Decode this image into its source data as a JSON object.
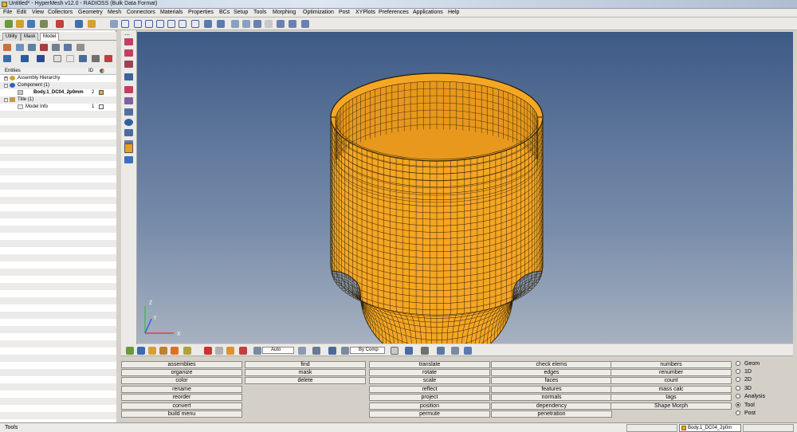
{
  "window": {
    "title": "Untitled* - HyperMesh v12.0 - RADIOSS (Bulk Data Format)"
  },
  "menu": [
    "File",
    "Edit",
    "View",
    "Collectors",
    "Geometry",
    "Mesh",
    "Connectors",
    "Materials",
    "Properties",
    "BCs",
    "Setup",
    "Tools",
    "Morphing",
    "Optimization",
    "Post",
    "XYPlots",
    "Preferences",
    "Applications",
    "Help"
  ],
  "tabs": [
    "Utility",
    "Mask",
    "Model"
  ],
  "entities": {
    "header": {
      "name": "Entities",
      "id": "ID"
    },
    "rows": [
      {
        "label": "Assembly Hierarchy",
        "id": ""
      },
      {
        "label": "Component (1)",
        "id": ""
      },
      {
        "label": "Body.1_DC04_2p0mm",
        "id": "2"
      },
      {
        "label": "Title (1)",
        "id": ""
      },
      {
        "label": "Model Info",
        "id": "1"
      }
    ]
  },
  "viewport": {
    "axis_x": "X",
    "axis_y": "Y",
    "axis_z": "Z"
  },
  "bottom_toolbar": {
    "mode": "Auto",
    "color_by": "By Comp"
  },
  "panel": {
    "columns": [
      [
        "assemblies",
        "organize",
        "color",
        "rename",
        "reorder",
        "convert",
        "build menu"
      ],
      [
        "find",
        "mask",
        "delete",
        "",
        "",
        "",
        ""
      ],
      [
        "translate",
        "rotate",
        "scale",
        "reflect",
        "project",
        "position",
        "permute"
      ],
      [
        "check elems",
        "edges",
        "faces",
        "features",
        "normals",
        "dependency",
        "penetration"
      ],
      [
        "numbers",
        "renumber",
        "count",
        "mass calc",
        "tags",
        "Shape Morph",
        ""
      ]
    ],
    "radios": [
      "Geom",
      "1D",
      "2D",
      "3D",
      "Analysis",
      "Tool",
      "Post"
    ],
    "selected_radio": "Tool"
  },
  "status": {
    "text": "Tools",
    "component": "Body.1_DC04_2p0m"
  },
  "colors": {
    "mesh": "#f5a623",
    "mesh_line": "#2a1e08",
    "viewport_top": "#3d5a86",
    "viewport_bottom": "#a7b1c0"
  }
}
